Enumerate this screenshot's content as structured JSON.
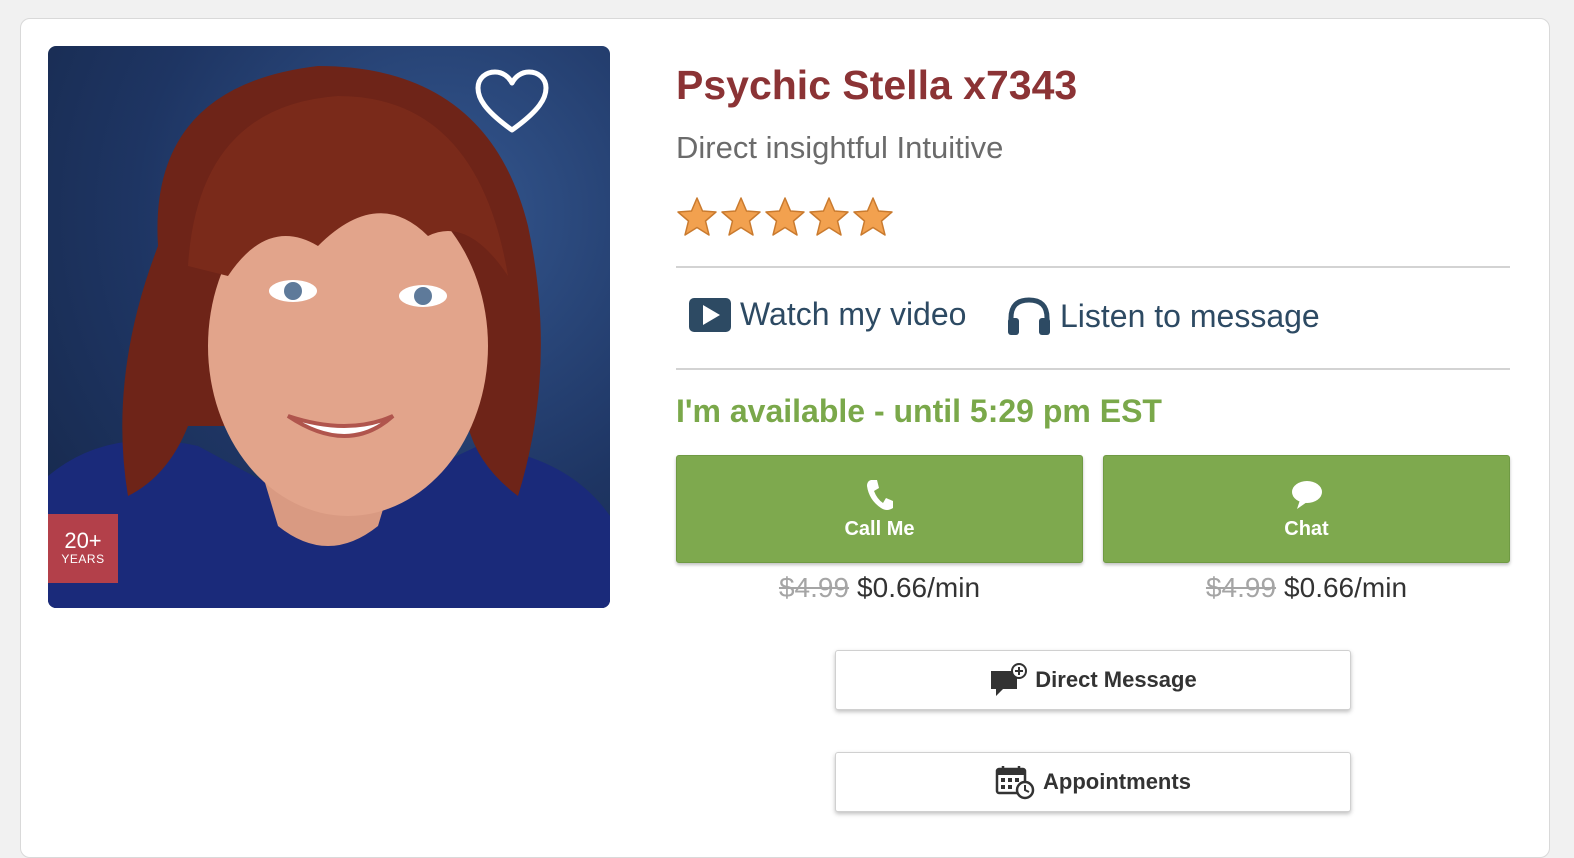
{
  "profile": {
    "name": "Psychic Stella x7343",
    "tagline": "Direct insightful Intuitive",
    "rating": 5,
    "rating_max": 5,
    "experience": {
      "value": "20+",
      "label": "YEARS"
    }
  },
  "media": {
    "video_label": "Watch my video",
    "message_label": "Listen to message"
  },
  "availability": "I'm available - until 5:29 pm EST",
  "actions": [
    {
      "label": "Call Me",
      "icon": "phone-icon",
      "old_price": "$4.99",
      "price": "$0.66/min"
    },
    {
      "label": "Chat",
      "icon": "chat-bubble-icon",
      "old_price": "$4.99",
      "price": "$0.66/min"
    }
  ],
  "buttons": {
    "direct_message": "Direct Message",
    "appointments": "Appointments"
  },
  "colors": {
    "name": "#8b3335",
    "available": "#7aa84a",
    "action_button": "#7ea94e",
    "years_badge": "#b3404a",
    "star": "#f2a14f",
    "link": "#2d4a63"
  }
}
